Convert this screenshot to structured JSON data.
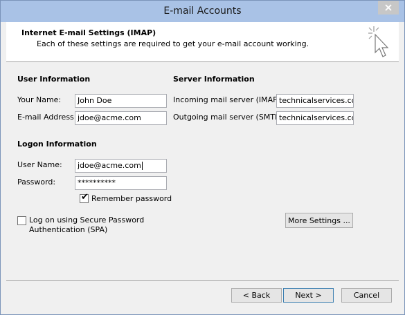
{
  "window": {
    "title": "E-mail Accounts"
  },
  "header": {
    "title": "Internet E-mail Settings (IMAP)",
    "subtitle": "Each of these settings are required to get your e-mail account working.",
    "icon": "cursor-sparkle-icon"
  },
  "user_info": {
    "heading": "User Information",
    "name_label": "Your Name:",
    "name_value": "John Doe",
    "email_label": "E-mail Address:",
    "email_value": "jdoe@acme.com"
  },
  "server_info": {
    "heading": "Server Information",
    "incoming_label": "Incoming mail server (IMAP):",
    "incoming_value": "technicalservices.com",
    "outgoing_label": "Outgoing mail server (SMTP):",
    "outgoing_value": "technicalservices.com"
  },
  "logon_info": {
    "heading": "Logon Information",
    "username_label": "User Name:",
    "username_value": "jdoe@acme.com",
    "password_label": "Password:",
    "password_value": "**********",
    "remember_label": "Remember password",
    "remember_checked": true
  },
  "spa": {
    "label_line1": "Log on using Secure Password",
    "label_line2": "Authentication (SPA)",
    "checked": false
  },
  "buttons": {
    "more_settings": "More Settings ...",
    "back": "< Back",
    "next": "Next >",
    "cancel": "Cancel"
  }
}
